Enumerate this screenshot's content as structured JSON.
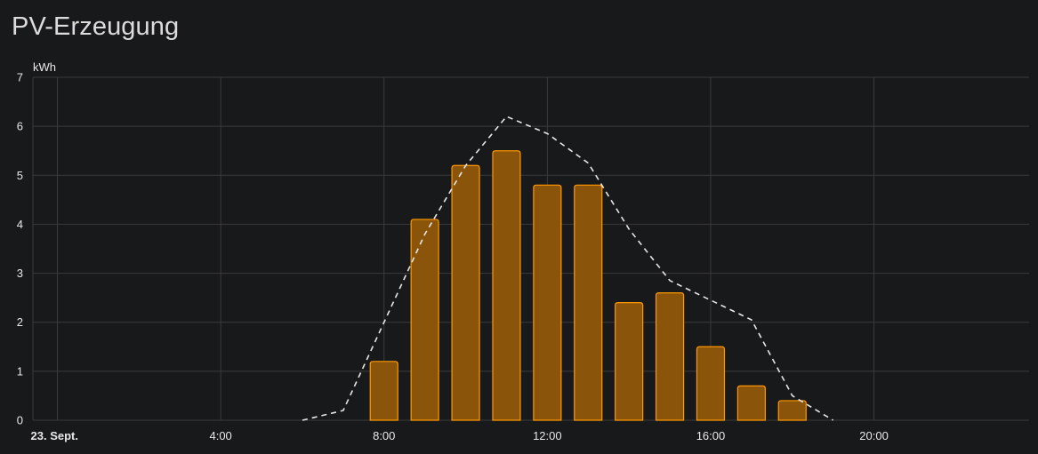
{
  "card": {
    "title": "PV-Erzeugung"
  },
  "colors": {
    "background": "#18191b",
    "grid": "#3a3b3d",
    "bar_fill": "#8a550b",
    "bar_stroke": "#ff9800",
    "forecast_line": "#e6e6e6"
  },
  "chart_data": {
    "type": "bar",
    "title": "PV-Erzeugung",
    "ylabel": "kWh",
    "ylim": [
      0,
      7
    ],
    "yticks": [
      "0",
      "1",
      "2",
      "3",
      "4",
      "5",
      "6",
      "7"
    ],
    "xlim_hours": [
      -0.6,
      23.8
    ],
    "xticks": [
      {
        "hour": 0,
        "label": "23. Sept.",
        "bold": true
      },
      {
        "hour": 4,
        "label": "4:00",
        "bold": false
      },
      {
        "hour": 8,
        "label": "8:00",
        "bold": false
      },
      {
        "hour": 12,
        "label": "12:00",
        "bold": false
      },
      {
        "hour": 16,
        "label": "16:00",
        "bold": false
      },
      {
        "hour": 20,
        "label": "20:00",
        "bold": false
      }
    ],
    "grid": true,
    "series": [
      {
        "type": "bar",
        "hours": [
          8,
          9,
          10,
          11,
          12,
          13,
          14,
          15,
          16,
          17,
          18
        ],
        "values": [
          1.2,
          4.1,
          5.2,
          5.5,
          4.8,
          4.8,
          2.4,
          2.6,
          1.5,
          0.7,
          0.4
        ]
      },
      {
        "type": "line",
        "style": "dashed",
        "hours": [
          6,
          7,
          8,
          9,
          10,
          11,
          12,
          13,
          14,
          15,
          16,
          17,
          18,
          19
        ],
        "values": [
          0,
          0.2,
          2.0,
          3.8,
          5.2,
          6.2,
          5.85,
          5.25,
          3.9,
          2.85,
          2.45,
          2.05,
          0.5,
          0
        ]
      }
    ]
  }
}
